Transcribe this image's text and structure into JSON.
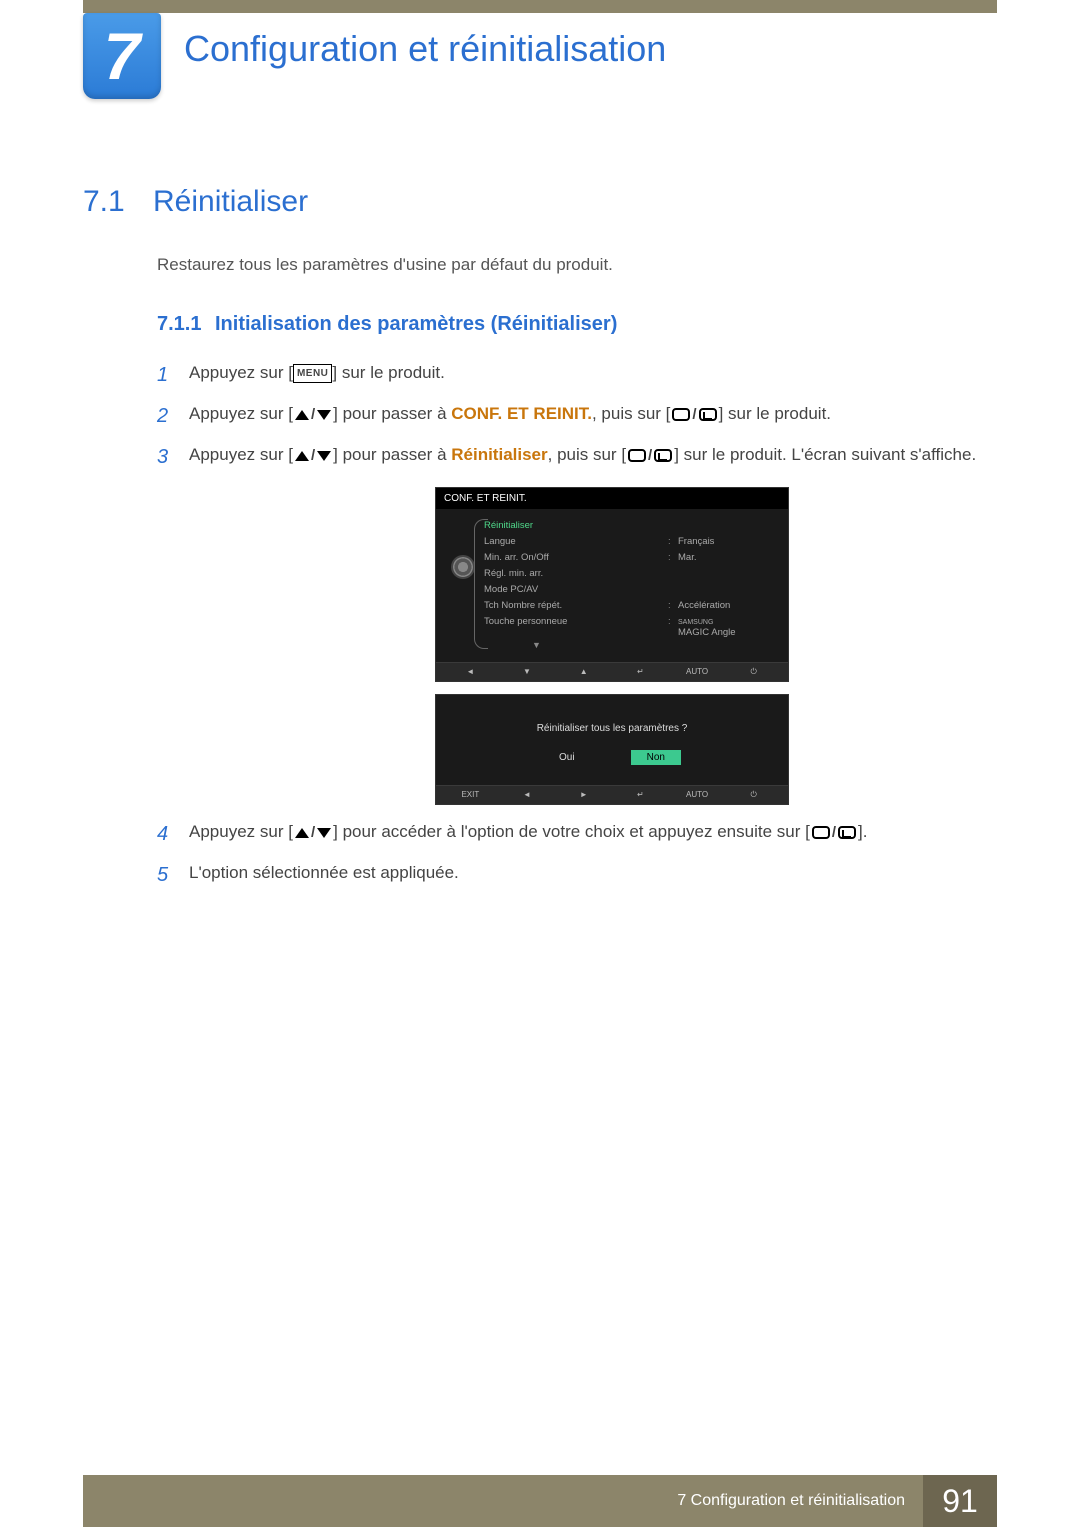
{
  "chapter": {
    "number": "7",
    "title": "Configuration et réinitialisation"
  },
  "section": {
    "number": "7.1",
    "title": "Réinitialiser"
  },
  "intro": "Restaurez tous les paramètres d'usine par défaut du produit.",
  "subsection": {
    "number": "7.1.1",
    "title": "Initialisation des paramètres (Réinitialiser)"
  },
  "steps": {
    "s1": {
      "n": "1",
      "pre": "Appuyez sur [",
      "menu": "MENU",
      "post": "] sur le produit."
    },
    "s2": {
      "n": "2",
      "pre": "Appuyez sur [",
      "mid": "] pour passer à ",
      "bold": "CONF. ET REINIT.",
      "after": ", puis sur [",
      "post": "] sur le produit."
    },
    "s3": {
      "n": "3",
      "pre": "Appuyez sur [",
      "mid": "] pour passer à ",
      "bold": "Réinitialiser",
      "after": ", puis sur [",
      "post": "] sur le produit. L'écran suivant s'affiche."
    },
    "s4": {
      "n": "4",
      "pre": "Appuyez sur [",
      "mid": "] pour accéder à l'option de votre choix et appuyez ensuite sur [",
      "post": "]."
    },
    "s5": {
      "n": "5",
      "text": "L'option sélectionnée est appliquée."
    }
  },
  "osd": {
    "title": "CONF. ET REINIT.",
    "rows": [
      {
        "label": "Réinitialiser",
        "value": "",
        "highlight": true
      },
      {
        "label": "Langue",
        "value": "Français"
      },
      {
        "label": "Min. arr. On/Off",
        "value": "Mar."
      },
      {
        "label": "Régl. min. arr.",
        "value": ""
      },
      {
        "label": "Mode PC/AV",
        "value": ""
      },
      {
        "label": "Tch Nombre répét.",
        "value": "Accélération"
      },
      {
        "label": "Touche personneue",
        "value": "MAGIC Angle",
        "magic": "SAMSUNG"
      }
    ],
    "footer": [
      "◄",
      "▼",
      "▲",
      "↵",
      "AUTO",
      "⏻"
    ],
    "confirm": {
      "question": "Réinitialiser tous les paramètres ?",
      "yes": "Oui",
      "no": "Non"
    },
    "confirm_footer": [
      "EXIT",
      "◄",
      "►",
      "↵",
      "AUTO",
      "⏻"
    ]
  },
  "footer": {
    "text": "7 Configuration et réinitialisation",
    "page": "91"
  }
}
